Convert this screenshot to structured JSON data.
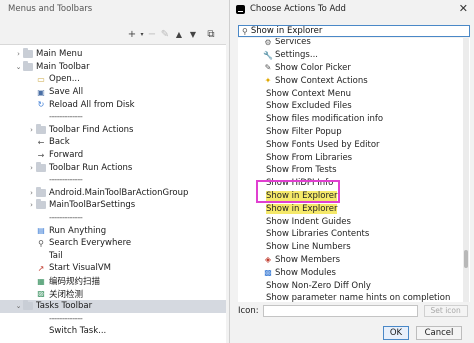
{
  "left": {
    "title": "Menus and Toolbars",
    "toolbar_icons": [
      "add",
      "add-dropdown",
      "remove",
      "edit",
      "move-up",
      "move-down",
      "restore"
    ],
    "items": [
      {
        "label": "Main Menu",
        "icon": "folder",
        "arrow": "collapsed"
      },
      {
        "label": "Main Toolbar",
        "icon": "folder",
        "arrow": "expanded"
      },
      {
        "label": "Open...",
        "icon": "open-folder"
      },
      {
        "label": "Save All",
        "icon": "save"
      },
      {
        "label": "Reload All from Disk",
        "icon": "reload"
      },
      {
        "label": "-------------",
        "icon": "none"
      },
      {
        "label": "Toolbar Find Actions",
        "icon": "folder",
        "arrow": "collapsed"
      },
      {
        "label": "Back",
        "icon": "arrow-left"
      },
      {
        "label": "Forward",
        "icon": "arrow-right"
      },
      {
        "label": "Toolbar Run Actions",
        "icon": "folder",
        "arrow": "collapsed"
      },
      {
        "label": "-------------",
        "icon": "none"
      },
      {
        "label": "Android.MainToolBarActionGroup",
        "icon": "folder",
        "arrow": "collapsed"
      },
      {
        "label": "MainToolBarSettings",
        "icon": "folder",
        "arrow": "collapsed"
      },
      {
        "label": "-------------",
        "icon": "none"
      },
      {
        "label": "Run Anything",
        "icon": "run"
      },
      {
        "label": "Search Everywhere",
        "icon": "search"
      },
      {
        "label": "Tail",
        "icon": "none"
      },
      {
        "label": "Start VisualVM",
        "icon": "visualvm"
      },
      {
        "label": "编码规约扫描",
        "icon": "scan"
      },
      {
        "label": "关闭检测",
        "icon": "close-check"
      },
      {
        "label": "Tasks Toolbar",
        "icon": "folder",
        "arrow": "expanded",
        "selected": true
      },
      {
        "label": "-------------",
        "icon": "none"
      },
      {
        "label": "Switch Task...",
        "icon": "none"
      }
    ]
  },
  "dialog": {
    "title": "Choose Actions To Add",
    "search_value": "Show in Explorer",
    "items": [
      {
        "label": "Services",
        "icon": "services"
      },
      {
        "label": "Settings...",
        "icon": "wrench"
      },
      {
        "label": "Show Color Picker",
        "icon": "color-picker"
      },
      {
        "label": "Show Context Actions",
        "icon": "bulb"
      },
      {
        "label": "Show Context Menu",
        "icon": "none"
      },
      {
        "label": "Show Excluded Files",
        "icon": "none"
      },
      {
        "label": "Show files modification info",
        "icon": "none"
      },
      {
        "label": "Show Filter Popup",
        "icon": "none"
      },
      {
        "label": "Show Fonts Used by Editor",
        "icon": "none"
      },
      {
        "label": "Show From Libraries",
        "icon": "none"
      },
      {
        "label": "Show From Tests",
        "icon": "none"
      },
      {
        "label": "Show HiDPI Info",
        "icon": "none"
      },
      {
        "label": "Show in Explorer",
        "icon": "none",
        "highlighted": true
      },
      {
        "label": "Show in Explorer",
        "icon": "none",
        "highlighted": true
      },
      {
        "label": "Show Indent Guides",
        "icon": "none"
      },
      {
        "label": "Show Libraries Contents",
        "icon": "none"
      },
      {
        "label": "Show Line Numbers",
        "icon": "none"
      },
      {
        "label": "Show Members",
        "icon": "members"
      },
      {
        "label": "Show Modules",
        "icon": "modules"
      },
      {
        "label": "Show Non-Zero Diff Only",
        "icon": "none"
      },
      {
        "label": "Show parameter name hints on completion",
        "icon": "none"
      }
    ],
    "icon_label": "Icon:",
    "set_icon_label": "Set icon",
    "ok_label": "OK",
    "cancel_label": "Cancel"
  },
  "colors": {
    "highlight": "#f5e96a",
    "annotation_box": "#e040d0",
    "focus_border": "#4a88c7",
    "selection": "#d5d9e0"
  }
}
